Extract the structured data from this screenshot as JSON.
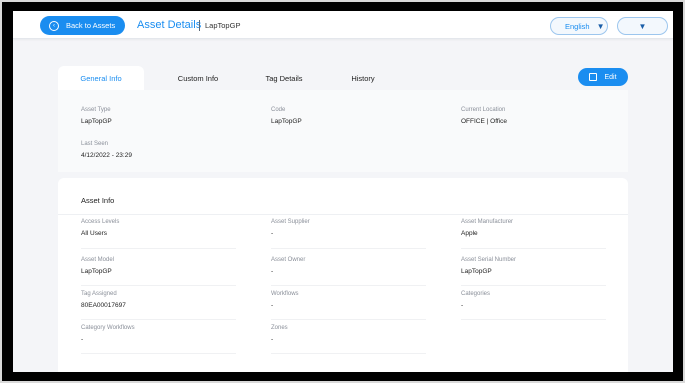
{
  "header": {
    "back_label": "Back to Assets",
    "title": "Asset Details",
    "subtitle": "LapTopGP",
    "language": "English"
  },
  "tabs": [
    {
      "label": "General Info",
      "active": true
    },
    {
      "label": "Custom Info",
      "active": false
    },
    {
      "label": "Tag Details",
      "active": false
    },
    {
      "label": "History",
      "active": false
    }
  ],
  "edit_label": "Edit",
  "general": [
    {
      "label": "Asset Type",
      "value": "LapTopGP"
    },
    {
      "label": "Code",
      "value": "LapTopGP"
    },
    {
      "label": "Current Location",
      "value": "OFFICE | Office"
    },
    {
      "label": "Last Seen",
      "value": "4/12/2022 - 23:29"
    }
  ],
  "asset_info": {
    "title": "Asset Info",
    "fields": [
      {
        "label": "Access Levels",
        "value": "All Users"
      },
      {
        "label": "Asset Supplier",
        "value": "-"
      },
      {
        "label": "Asset Manufacturer",
        "value": "Apple"
      },
      {
        "label": "Asset Model",
        "value": "LapTopGP"
      },
      {
        "label": "Asset Owner",
        "value": "-"
      },
      {
        "label": "Asset Serial Number",
        "value": "LapTopGP"
      },
      {
        "label": "Tag Assigned",
        "value": "80EA00017697"
      },
      {
        "label": "Workflows",
        "value": "-"
      },
      {
        "label": "Categories",
        "value": "-"
      },
      {
        "label": "Category Workflows",
        "value": "-"
      },
      {
        "label": "Zones",
        "value": "-"
      }
    ]
  },
  "colors": {
    "accent": "#1a8df0",
    "label": "#8a8f99",
    "text": "#222222"
  }
}
